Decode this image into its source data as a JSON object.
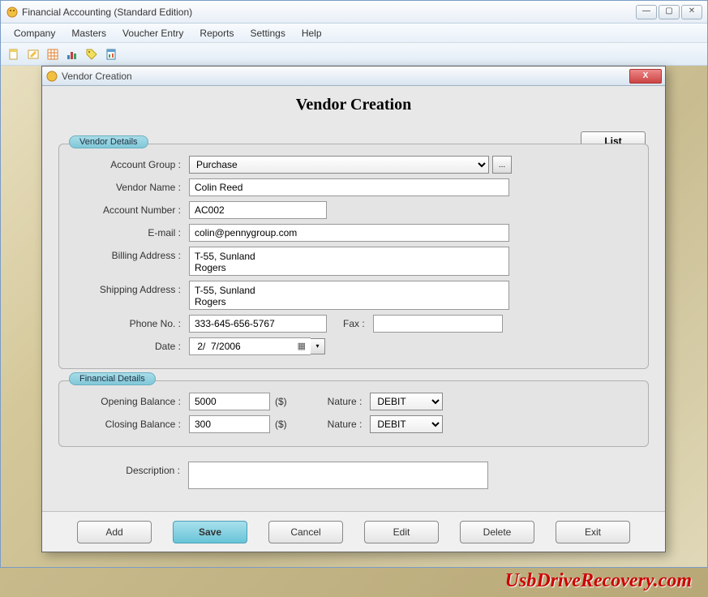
{
  "window": {
    "title": "Financial Accounting (Standard Edition)"
  },
  "menu": [
    "Company",
    "Masters",
    "Voucher Entry",
    "Reports",
    "Settings",
    "Help"
  ],
  "dialog": {
    "title": "Vendor Creation",
    "heading": "Vendor Creation",
    "list_btn": "List"
  },
  "vendor_details": {
    "legend": "Vendor Details",
    "labels": {
      "account_group": "Account Group :",
      "vendor_name": "Vendor Name :",
      "account_number": "Account Number :",
      "email": "E-mail :",
      "billing_address": "Billing Address :",
      "shipping_address": "Shipping Address :",
      "phone": "Phone No. :",
      "fax": "Fax :",
      "date": "Date :"
    },
    "values": {
      "account_group": "Purchase",
      "vendor_name": "Colin Reed",
      "account_number": "AC002",
      "email": "colin@pennygroup.com",
      "billing_address": "T-55, Sunland\nRogers",
      "shipping_address": "T-55, Sunland\nRogers",
      "phone": "333-645-656-5767",
      "fax": "",
      "date": " 2/  7/2006"
    }
  },
  "financial_details": {
    "legend": "Financial Details",
    "labels": {
      "opening_balance": "Opening Balance :",
      "closing_balance": "Closing Balance :",
      "nature": "Nature :",
      "currency": "($)"
    },
    "values": {
      "opening_balance": "5000",
      "closing_balance": "300",
      "opening_nature": "DEBIT",
      "closing_nature": "DEBIT"
    }
  },
  "description": {
    "label": "Description :",
    "value": ""
  },
  "buttons": {
    "add": "Add",
    "save": "Save",
    "cancel": "Cancel",
    "edit": "Edit",
    "delete": "Delete",
    "exit": "Exit"
  },
  "watermark": "UsbDriveRecovery.com"
}
